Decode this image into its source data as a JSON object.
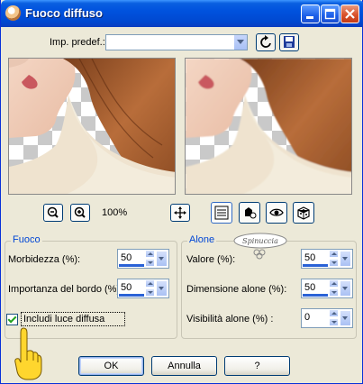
{
  "window": {
    "title": "Fuoco diffuso"
  },
  "toolbar": {
    "preset_label": "Imp. predef.:",
    "preset_value": ""
  },
  "zoom": {
    "level": "100%"
  },
  "group_focus": {
    "title": "Fuoco",
    "softness": {
      "label": "Morbidezza (%):",
      "value": "50"
    },
    "edge_importance": {
      "label": "Importanza del bordo (%):",
      "value": "50"
    },
    "include_glow": {
      "label": "Includi luce diffusa",
      "checked": true
    }
  },
  "group_halo": {
    "title": "Alone",
    "value": {
      "label": "Valore (%):",
      "value": "50"
    },
    "size": {
      "label": "Dimensione alone (%):",
      "value": "50"
    },
    "visibility": {
      "label": "Visibilità alone (%) :",
      "value": "0"
    }
  },
  "watermark": {
    "text": "Spinuccia"
  },
  "buttons": {
    "ok": "OK",
    "cancel": "Annulla",
    "help": "?"
  },
  "colors": {
    "titlebar": "#0052de",
    "dialog_bg": "#ece9d8",
    "group_title": "#0046d5",
    "close_button": "#d9522c"
  }
}
